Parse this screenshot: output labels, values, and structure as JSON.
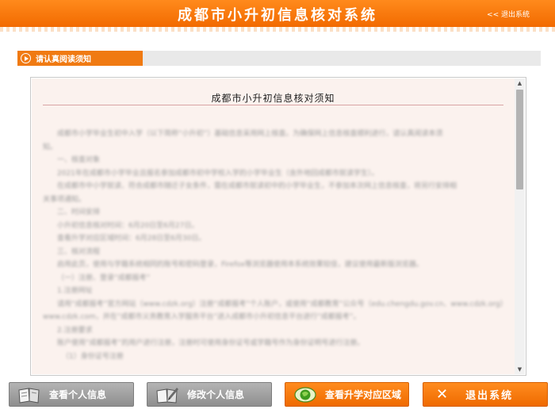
{
  "header": {
    "title": "成都市小升初信息核对系统",
    "exit_link": "<< 退出系统"
  },
  "tab": {
    "label": "请认真阅读须知",
    "icon": "play-circle-icon"
  },
  "notice": {
    "title": "成都市小升初信息核对须知",
    "paragraphs": [
      "成都市小学毕业生初中入学（以下简称“小升初”）基础信息采用网上核查。为确保网上信息核查顺利进行，请认真阅读本须",
      "知。",
      "一、核查对象",
      "2021年在成都市小学毕业且报名参加成都市初中学校入学的小学毕业生（含外地回成都市就读学生）。",
      "在成都市中小学就读、符合成都市随迁子女条件，需在成都市就读初中的小学毕业生，不参加本次网上信息核查，将另行安排相",
      "关事项通知。",
      "二、时间安排",
      "小升初信息核对时间：6月20日至6月27日。",
      "查看升学对应区域时间：6月28日至6月30日。",
      "三、核对流程",
      "启用此页，使用与学籍系统相同的账号和密码登录，Firefox等浏览器使用本系统效果较佳，建议使用最新版浏览器。",
      "（一）注册、登录“成都报考”",
      "1.注册网址",
      "请用“成都报考”官方网站（www.cdzk.org）注册“成都报考”个人账户，或使用“成都教育”公众号（edu.chengdu.gov.cn、www.cdzk.org）",
      "www.cdzk.com，并在“成都市义务教育入学服务平台”进入成都市小升初信息平台进行“成都报考”。",
      "2.注册要求",
      "账户使用“成都报考”的用户进行注册，注册时可使用身份证号或学籍号作为身份证明号进行注册。",
      "（1）身份证号注册"
    ]
  },
  "buttons": {
    "view_info": {
      "label": "查看个人信息",
      "icon": "book-icon"
    },
    "edit_info": {
      "label": "修改个人信息",
      "icon": "edit-book-icon"
    },
    "view_area": {
      "label": "查看升学对应区域",
      "icon": "globe-icon"
    },
    "exit": {
      "label": "退出系统",
      "icon": "close-icon"
    }
  },
  "colors": {
    "accent": "#f07a12",
    "header_bg": "#f26a00",
    "content_bg": "#fbf2ee",
    "button_gray": "#9e9e9e"
  }
}
